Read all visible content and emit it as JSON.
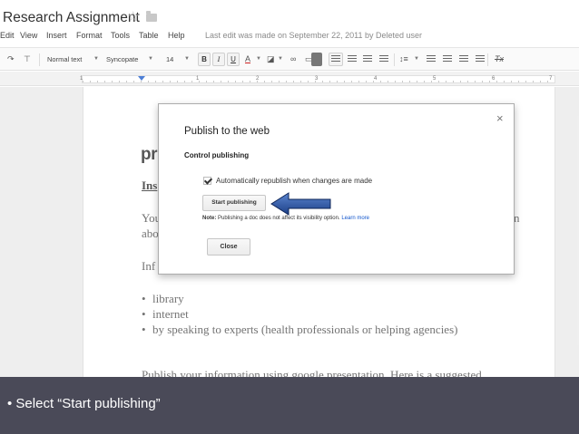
{
  "doc": {
    "title": "Research Assignment",
    "last_edit": "Last edit was made on September 22, 2011 by Deleted user"
  },
  "menu": [
    "Edit",
    "View",
    "Insert",
    "Format",
    "Tools",
    "Table",
    "Help"
  ],
  "toolbar": {
    "style": "Normal text",
    "font": "Syncopate",
    "size": "14",
    "bold": "B",
    "italic": "I",
    "underline": "U",
    "text_color": "A",
    "clear_format": "Tx"
  },
  "ruler": [
    "1",
    "1",
    "2",
    "3",
    "4",
    "5",
    "6",
    "7"
  ],
  "document": {
    "heading": "pr",
    "line_ins": "Ins",
    "line_you": "You",
    "line_you_end": "n",
    "line_abo": "abo",
    "line_inf": "Inf",
    "bullets": [
      "library",
      "internet",
      "by speaking to experts (health professionals or helping agencies)"
    ],
    "bottom_line": "Publish your information using google presentation.     Here is a suggested"
  },
  "dialog": {
    "title": "Publish to the web",
    "close_icon": "×",
    "section": "Control publishing",
    "checkbox_label": "Automatically republish when changes are made",
    "checkbox_checked": true,
    "start_button": "Start publishing",
    "note_label": "Note:",
    "note_text": " Publishing a doc does not affect its visibility option. ",
    "learn_more": "Learn more",
    "close_button": "Close"
  },
  "caption": "•  Select “Start publishing”",
  "colors": {
    "arrow": "#1f4f9e",
    "caption_bg": "#4a4a58",
    "link": "#1155cc"
  }
}
